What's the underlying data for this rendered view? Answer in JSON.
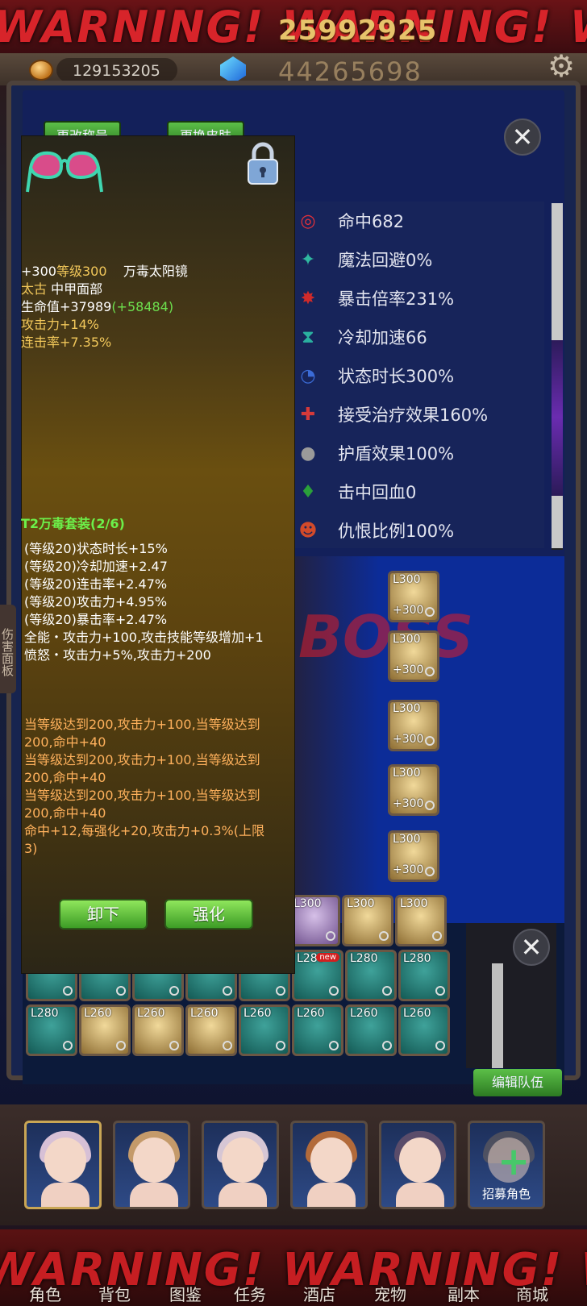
{
  "header": {
    "warning": "WARNING! WARNING! WARNING!",
    "boss_hp": "25992925",
    "gold": "129153205",
    "gem_count": "44265698"
  },
  "panel": {
    "change_title": "更改称号",
    "change_skin": "更换皮肤"
  },
  "stats": [
    {
      "icon": "target-icon",
      "label": "命中682",
      "color": "#e0303a",
      "glyph": "◎"
    },
    {
      "icon": "magic-dodge-icon",
      "label": "魔法回避0%",
      "color": "#2fb8a0",
      "glyph": "✦"
    },
    {
      "icon": "crit-multiplier-icon",
      "label": "暴击倍率231%",
      "color": "#d02a2a",
      "glyph": "✸"
    },
    {
      "icon": "cooldown-icon",
      "label": "冷却加速66",
      "color": "#2ab0a0",
      "glyph": "⧗"
    },
    {
      "icon": "status-duration-icon",
      "label": "状态时长300%",
      "color": "#3b6bd6",
      "glyph": "◔"
    },
    {
      "icon": "healing-received-icon",
      "label": "接受治疗效果160%",
      "color": "#d63a3a",
      "glyph": "✚"
    },
    {
      "icon": "shield-effect-icon",
      "label": "护盾效果100%",
      "color": "#9a9a9a",
      "glyph": "●"
    },
    {
      "icon": "lifesteal-icon",
      "label": "击中回血0",
      "color": "#2aa03a",
      "glyph": "♦"
    },
    {
      "icon": "threat-icon",
      "label": "仇恨比例100%",
      "color": "#d24a2a",
      "glyph": "☻"
    }
  ],
  "tooltip": {
    "enhance": "+300",
    "level_text": "等级300",
    "item_name": "万毒太阳镜",
    "rarity": "太古",
    "slot_type": "中甲面部",
    "hp_text": "生命值+37989",
    "hp_bonus": "(+58484)",
    "atk": "攻击力+14%",
    "combo": "连击率+7.35%",
    "set_title": "T2万毒套装(2/6)",
    "set_lines": [
      "(等级20)状态时长+15%",
      "(等级20)冷却加速+2.47",
      "(等级20)连击率+2.47%",
      "(等级20)攻击力+4.95%",
      "(等级20)暴击率+2.47%",
      "全能・攻击力+100,攻击技能等级增加+1",
      "愤怒・攻击力+5%,攻击力+200"
    ],
    "cond_lines": [
      "当等级达到200,攻击力+100,当等级达到",
      "200,命中+40",
      "当等级达到200,攻击力+100,当等级达到",
      "200,命中+40",
      "当等级达到200,攻击力+100,当等级达到",
      "200,命中+40",
      "命中+12,每强化+20,攻击力+0.3%(上限",
      "3)"
    ],
    "unequip": "卸下",
    "strengthen": "强化"
  },
  "side_tab": "伤害面板",
  "boss_label": "BOSS",
  "equip_slots": [
    {
      "lv": "L300",
      "plus": "+300"
    },
    {
      "lv": "L300",
      "plus": "+300"
    },
    {
      "lv": "L300",
      "plus": "+300"
    },
    {
      "lv": "L300",
      "plus": "+300"
    },
    {
      "lv": "L300",
      "plus": "+300"
    }
  ],
  "inventory": {
    "row1": [
      "L300",
      "L300",
      "L300"
    ],
    "row2": [
      "",
      "",
      "",
      "",
      "",
      "L280",
      "L280",
      "L280"
    ],
    "row2_new": "new",
    "row3": [
      "L280",
      "L260",
      "L260",
      "L260",
      "L260",
      "L260",
      "L260",
      "L260"
    ],
    "edit_team": "编辑队伍"
  },
  "heroes": {
    "recruit": "招募角色"
  },
  "nav": [
    "角色",
    "背包",
    "图鉴",
    "任务",
    "酒店",
    "宠物",
    "副本",
    "商城"
  ]
}
